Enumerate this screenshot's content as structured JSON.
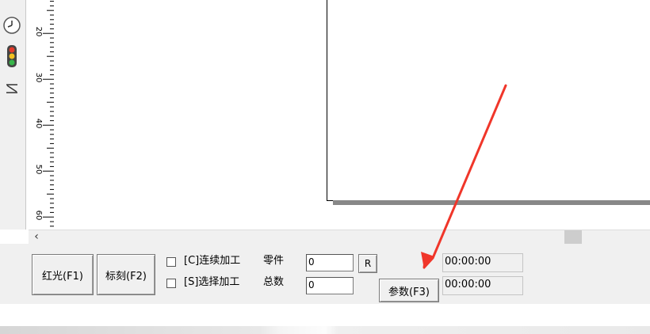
{
  "ruler": {
    "labels": [
      "20",
      "30",
      "40",
      "50",
      "60"
    ]
  },
  "toolbar": {
    "icons": [
      "clock-icon",
      "traffic-light-icon",
      "zoom-icon"
    ]
  },
  "controls": {
    "redlight_label": "红光(F1)",
    "mark_label": "标刻(F2)",
    "continuous_label": "[C]连续加工",
    "continuous_checked": false,
    "select_label": "[S]选择加工",
    "select_checked": false,
    "parts_label": "零件",
    "parts_value": "0",
    "total_label": "总数",
    "total_value": "0",
    "reset_label": "R",
    "param_label": "参数(F3)",
    "time1": "00:00:00",
    "time2": "00:00:00"
  },
  "colors": {
    "annotation_arrow": "#f0362a",
    "panel_bg": "#f0f0f0"
  }
}
